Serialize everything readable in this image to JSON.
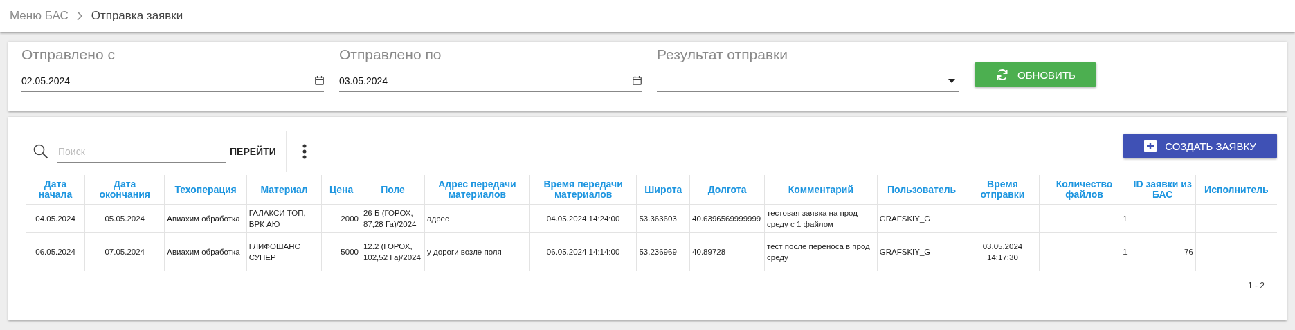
{
  "breadcrumb": {
    "items": [
      "Меню БАС",
      "Отправка заявки"
    ]
  },
  "filters": {
    "fields": [
      {
        "kind": "date",
        "label": "Отправлено с",
        "value": "02.05.2024"
      },
      {
        "kind": "date",
        "label": "Отправлено по",
        "value": "03.05.2024"
      },
      {
        "kind": "select",
        "label": "Результат отправки"
      }
    ],
    "refresh_button": "ОБНОВИТЬ"
  },
  "toolbar": {
    "search": {
      "placeholder": "Поиск"
    },
    "go_button": "ПЕРЕЙТИ",
    "create_button": "СОЗДАТЬ ЗАЯВКУ"
  },
  "table": {
    "columns": [
      "Дата начала",
      "Дата окончания",
      "Техоперация",
      "Материал",
      "Цена",
      "Поле",
      "Адрес передачи материалов",
      "Время передачи материалов",
      "Широта",
      "Долгота",
      "Комментарий",
      "Пользователь",
      "Время отправки",
      "Количество файлов",
      "ID заявки из БАС",
      "Исполнитель"
    ],
    "rows": [
      {
        "cells": [
          "04.05.2024",
          "05.05.2024",
          "Авиахим обработка",
          "ГАЛАКСИ ТОП, ВРК АЮ",
          "2000",
          "26 Б (ГОРОХ, 87,28 Га)/2024",
          "адрес",
          "04.05.2024 14:24:00",
          "53.363603",
          "40.6396569999999",
          "тестовая заявка на прод среду с 1 файлом",
          "GRAFSKIY_G",
          null,
          "1",
          null,
          null
        ]
      },
      {
        "cells": [
          "06.05.2024",
          "07.05.2024",
          "Авиахим обработка",
          "ГЛИФОШАНС СУПЕР",
          "5000",
          "12.2 (ГОРОХ, 102,52 Га)/2024",
          "у дороги возле поля",
          "06.05.2024 14:14:00",
          "53.236969",
          "40.89728",
          "тест после переноса в прод среду",
          "GRAFSKIY_G",
          "03.05.2024 14:17:30",
          "1",
          "76",
          null
        ]
      }
    ],
    "pager": "1 - 2"
  }
}
